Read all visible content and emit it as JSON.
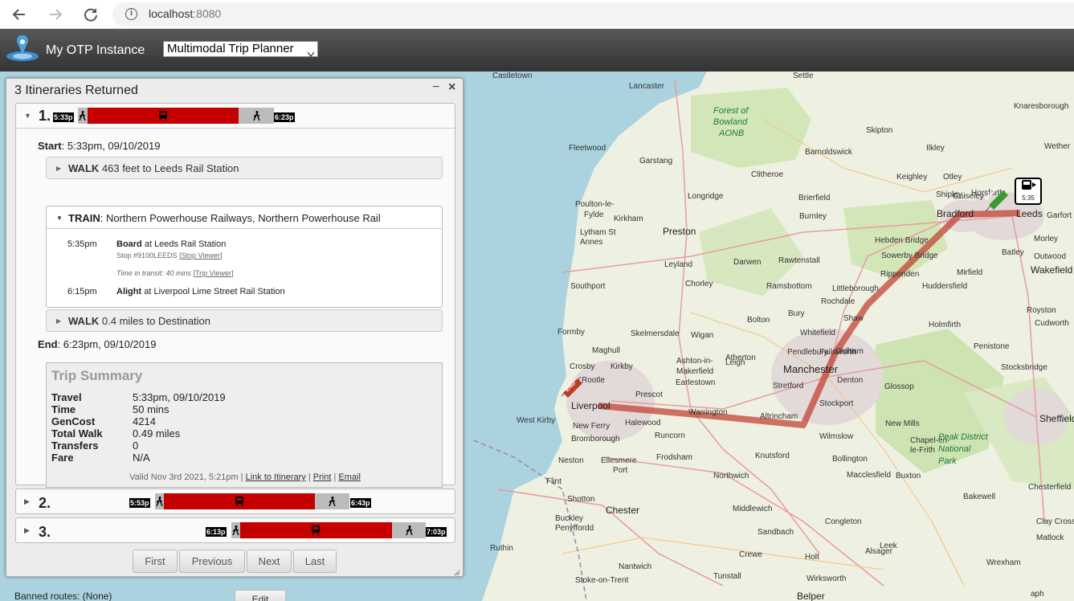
{
  "browser": {
    "url_host": "localhost",
    "url_port": ":8080"
  },
  "app": {
    "title": "My OTP Instance",
    "mode_select": "Multimodal Trip Planner"
  },
  "panel": {
    "title": "3 Itineraries Returned",
    "minimize": "−",
    "close": "×"
  },
  "itineraries": [
    {
      "number": "1.",
      "start_label": "5:33p",
      "end_label": "6:23p"
    },
    {
      "number": "2.",
      "start_label": "5:53p",
      "end_label": "6:43p"
    },
    {
      "number": "3.",
      "start_label": "6:13p",
      "end_label": "7:03p"
    }
  ],
  "detail": {
    "start_label": "Start",
    "start_value": ": 5:33pm, 09/10/2019",
    "walk1_mode": "WALK",
    "walk1_text": " 463 feet to Leeds Rail Station",
    "train_mode": "TRAIN",
    "train_text": ": Northern Powerhouse Railways, Northern Powerhouse Rail",
    "board_time": "5:35pm",
    "board_verb": "Board",
    "board_text": " at Leeds Rail Station",
    "stop_id": "Stop #9100LEEDS [",
    "stop_viewer": "Stop Viewer",
    "transit_time": "Time in transit: 40 mins",
    "trip_viewer": "Trip Viewer",
    "alight_time": "6:15pm",
    "alight_verb": "Alight",
    "alight_text": " at Liverpool Lime Street Rail Station",
    "walk2_mode": "WALK",
    "walk2_text": " 0.4 miles to Destination",
    "end_label": "End",
    "end_value": ": 6:23pm, 09/10/2019"
  },
  "summary": {
    "title": "Trip Summary",
    "rows": [
      {
        "k": "Travel",
        "v": "5:33pm, 09/10/2019"
      },
      {
        "k": "Time",
        "v": "50 mins"
      },
      {
        "k": "GenCost",
        "v": "4214"
      },
      {
        "k": "Total Walk",
        "v": "0.49 miles"
      },
      {
        "k": "Transfers",
        "v": "0"
      },
      {
        "k": "Fare",
        "v": "N/A"
      }
    ],
    "valid_text": "Valid Nov 3rd 2021, 5:21pm | ",
    "link_itinerary": "Link to Itinerary",
    "print": "Print",
    "email": "Email"
  },
  "pager": {
    "first": "First",
    "previous": "Previous",
    "next": "Next",
    "last": "Last"
  },
  "below": {
    "banned_routes": "Banned routes: (None)",
    "edit": "Edit"
  },
  "map": {
    "start_marker": "START",
    "end_marker": "END",
    "stop_time": "5:35",
    "labels": [
      "Castletown",
      "Lancaster",
      "Settle",
      "Forest of",
      "Bowland",
      "AONB",
      "Knaresborough",
      "Skipton",
      "Fleetwood",
      "Barnoldswick",
      "Ilkley",
      "Wether",
      "Garstang",
      "Keighley",
      "Otley",
      "Guiseley",
      "Poulton-le-",
      "Fylde",
      "Clitheroe",
      "Longridge",
      "Brierfield",
      "Shipley",
      "Horsforth",
      "Burnley",
      "Bradford",
      "Leeds",
      "Garfort",
      "Kirkham",
      "Preston",
      "Lytham St",
      "Annes",
      "Hebden Bridge",
      "Morley",
      "Batley",
      "Outwood",
      "Wakefield",
      "Leyland",
      "Darwen",
      "Rawtenstall",
      "Sowerby Bridge",
      "Mirfield",
      "Southport",
      "Chorley",
      "Ramsbottom",
      "Littleborough",
      "Ripponden",
      "Huddersfield",
      "Rochdale",
      "Bury",
      "Shaw",
      "Royston",
      "Bolton",
      "Holmfirth",
      "Cudworth",
      "Formby",
      "Skelmersdale",
      "Wigan",
      "Whitefield",
      "Oldham",
      "Penistone",
      "Maghull",
      "Atherton",
      "Pendlebury",
      "Failsworth",
      "Leigh",
      "Manchester",
      "Denton",
      "Stocksbridge",
      "Crosby",
      "Kirkby",
      "Ashton-in-",
      "Makerfield",
      "Rootle",
      "Earlestown",
      "Stretford",
      "Glossop",
      "Prescot",
      "Liverpool",
      "Warrington",
      "Altrincham",
      "Stockport",
      "Sheffield",
      "West Kirby",
      "Halewood",
      "New Ferry",
      "Runcorn",
      "Wilmslow",
      "New Mills",
      "Bromborough",
      "Chapel-en-",
      "le-Frith",
      "Peak District",
      "National",
      "Park",
      "Neston",
      "Ellesmere",
      "Port",
      "Frodsham",
      "Knutsford",
      "Bollington",
      "Flint",
      "Northwich",
      "Macclesfield",
      "Buxton",
      "Chesterfield",
      "Shotton",
      "Chester",
      "Middlewich",
      "Bakewell",
      "Buckley",
      "Penyffordd",
      "Congleton",
      "Clay Cross",
      "Sandbach",
      "Matlock",
      "Ruthin",
      "Crewe",
      "Alsager",
      "Leek",
      "Holt",
      "Nantwich",
      "Tunstall",
      "Wirksworth",
      "Wrexham",
      "Stoke-on-Trent",
      "Belper",
      "aph"
    ]
  }
}
